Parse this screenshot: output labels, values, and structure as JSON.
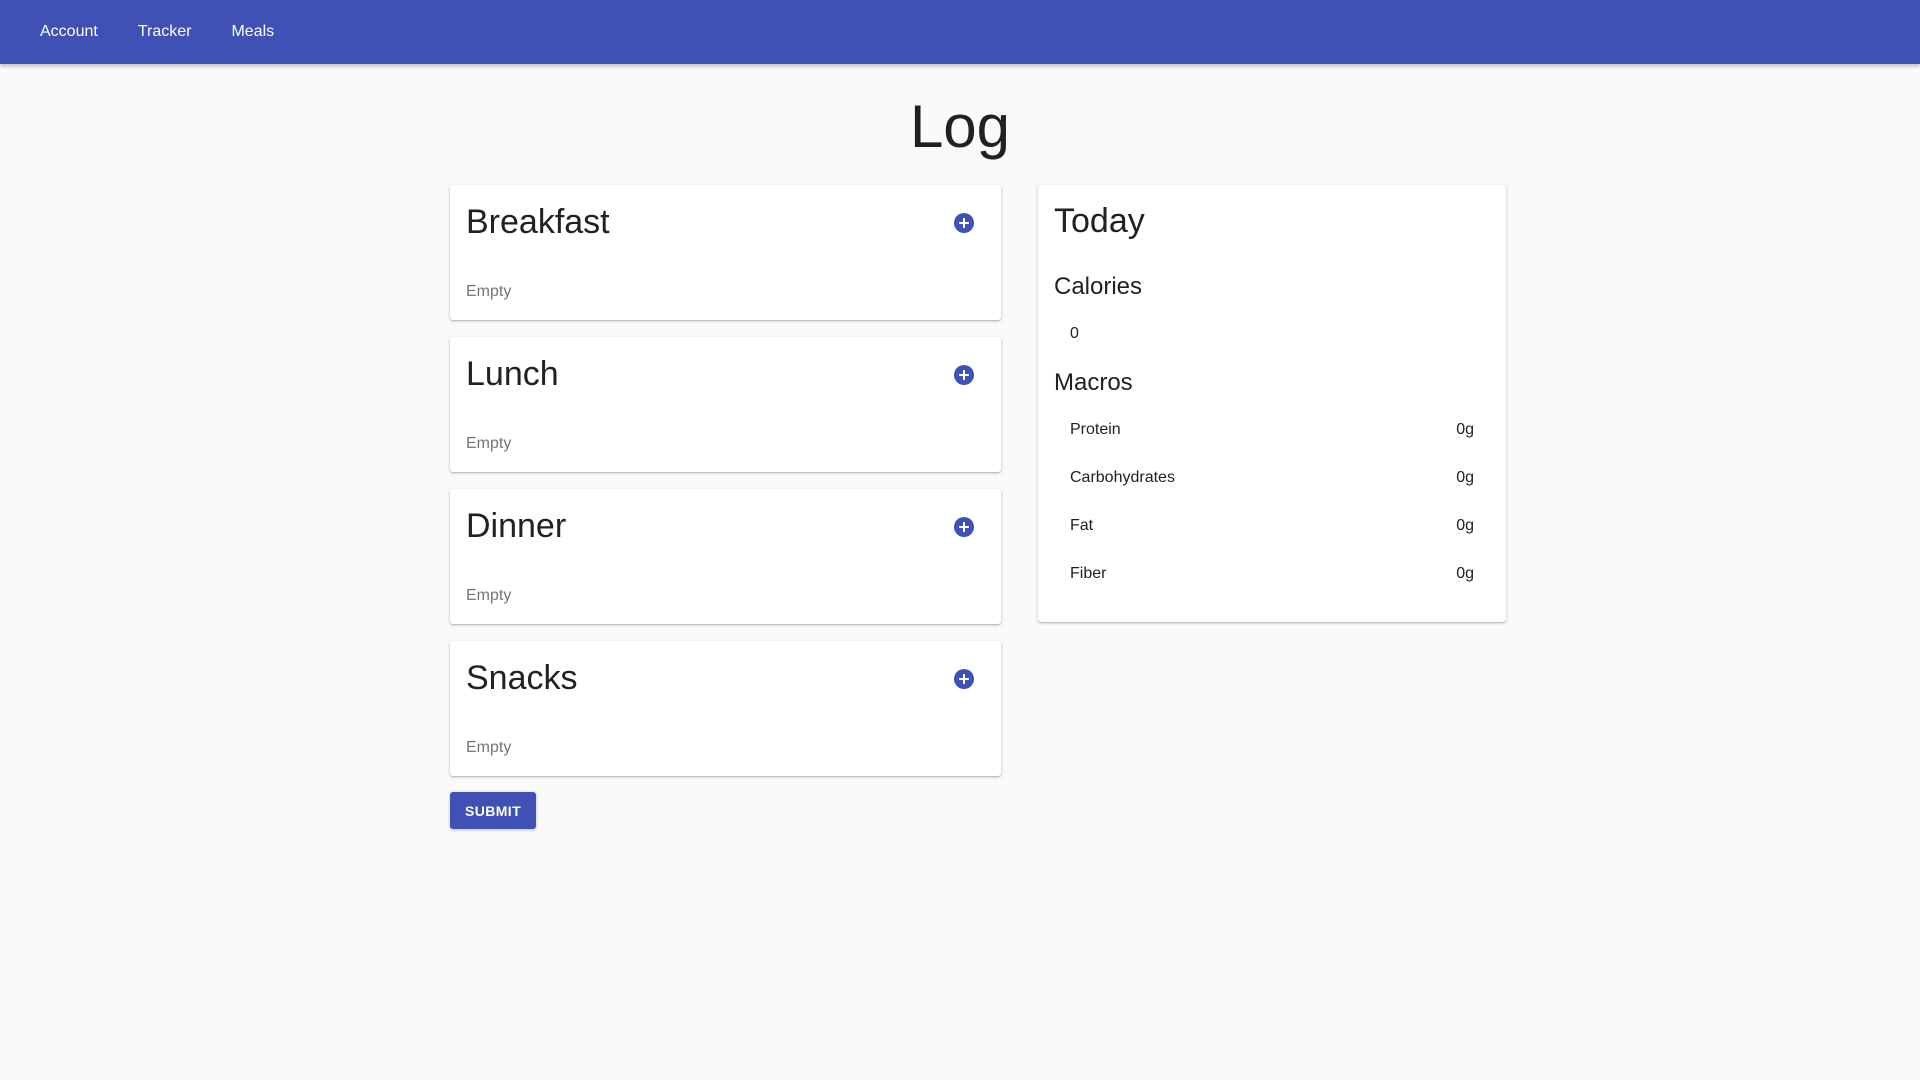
{
  "nav": {
    "items": [
      {
        "label": "Account"
      },
      {
        "label": "Tracker"
      },
      {
        "label": "Meals"
      }
    ]
  },
  "page": {
    "title": "Log"
  },
  "meals": [
    {
      "title": "Breakfast",
      "status": "Empty",
      "add_icon": "plus-circle-icon"
    },
    {
      "title": "Lunch",
      "status": "Empty",
      "add_icon": "plus-circle-icon"
    },
    {
      "title": "Dinner",
      "status": "Empty",
      "add_icon": "plus-circle-icon"
    },
    {
      "title": "Snacks",
      "status": "Empty",
      "add_icon": "plus-circle-icon"
    }
  ],
  "submit": {
    "label": "SUBMIT"
  },
  "today": {
    "title": "Today",
    "calories_heading": "Calories",
    "calories_value": "0",
    "macros_heading": "Macros",
    "macros": [
      {
        "name": "Protein",
        "value": "0g"
      },
      {
        "name": "Carbohydrates",
        "value": "0g"
      },
      {
        "name": "Fat",
        "value": "0g"
      },
      {
        "name": "Fiber",
        "value": "0g"
      }
    ]
  },
  "colors": {
    "primary": "#3f51b5",
    "background": "#fafafa",
    "card": "#ffffff",
    "muted_text": "#757575"
  }
}
